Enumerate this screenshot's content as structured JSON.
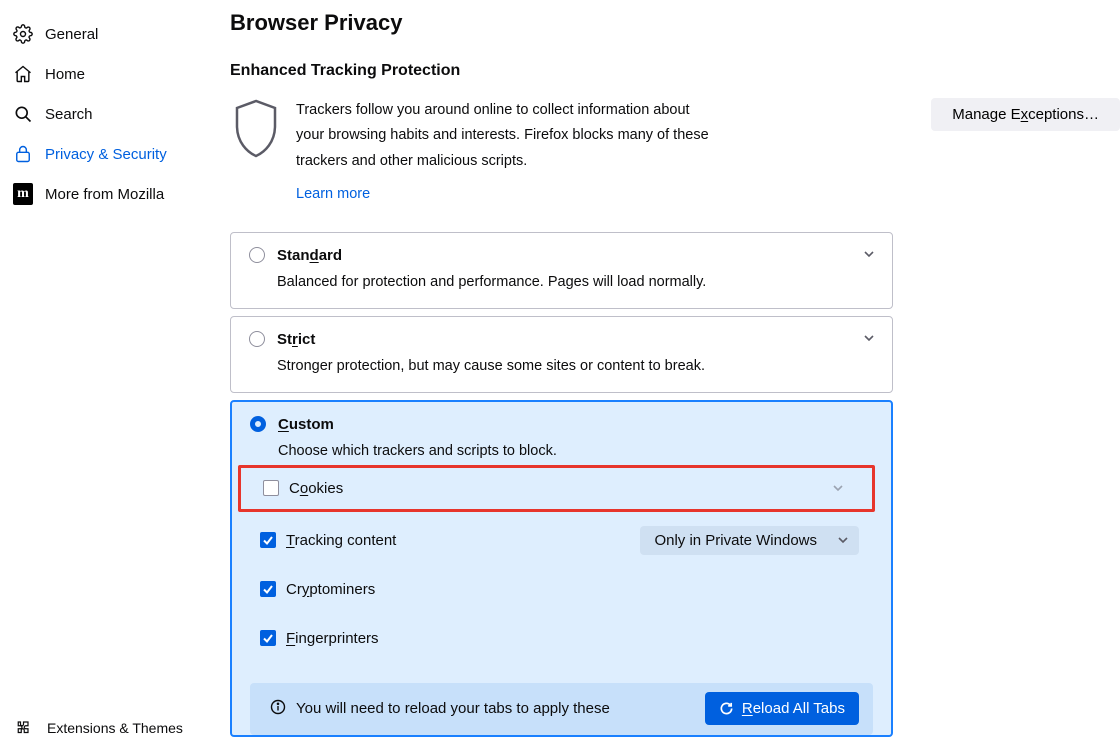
{
  "sidebar": {
    "items": [
      {
        "label": "General"
      },
      {
        "label": "Home"
      },
      {
        "label": "Search"
      },
      {
        "label": "Privacy & Security"
      },
      {
        "label": "More from Mozilla"
      }
    ],
    "bottom": {
      "label": "Extensions & Themes"
    }
  },
  "page": {
    "title": "Browser Privacy",
    "section_title": "Enhanced Tracking Protection",
    "etp_text": "Trackers follow you around online to collect information about your browsing habits and interests. Firefox blocks many of these trackers and other malicious scripts.",
    "learn_more": "Learn more",
    "manage_exceptions": "Manage Exceptions…"
  },
  "options": {
    "standard": {
      "title_pre": "Stan",
      "title_u": "d",
      "title_post": "ard",
      "desc": "Balanced for protection and performance. Pages will load normally."
    },
    "strict": {
      "title_pre": "St",
      "title_u": "r",
      "title_post": "ict",
      "desc": "Stronger protection, but may cause some sites or content to break."
    },
    "custom": {
      "title_u": "C",
      "title_post": "ustom",
      "desc": "Choose which trackers and scripts to block."
    }
  },
  "custom": {
    "cookies": {
      "pre": "C",
      "u": "o",
      "post": "okies"
    },
    "tracking": {
      "u": "T",
      "post": "racking content",
      "select": "Only in Private Windows"
    },
    "crypto": {
      "pre": "Cr",
      "u": "y",
      "post": "ptominers"
    },
    "finger": {
      "u": "F",
      "post": "ingerprinters"
    }
  },
  "notice": {
    "text": "You will need to reload your tabs to apply these",
    "button_u": "R",
    "button_post": "eload All Tabs"
  }
}
